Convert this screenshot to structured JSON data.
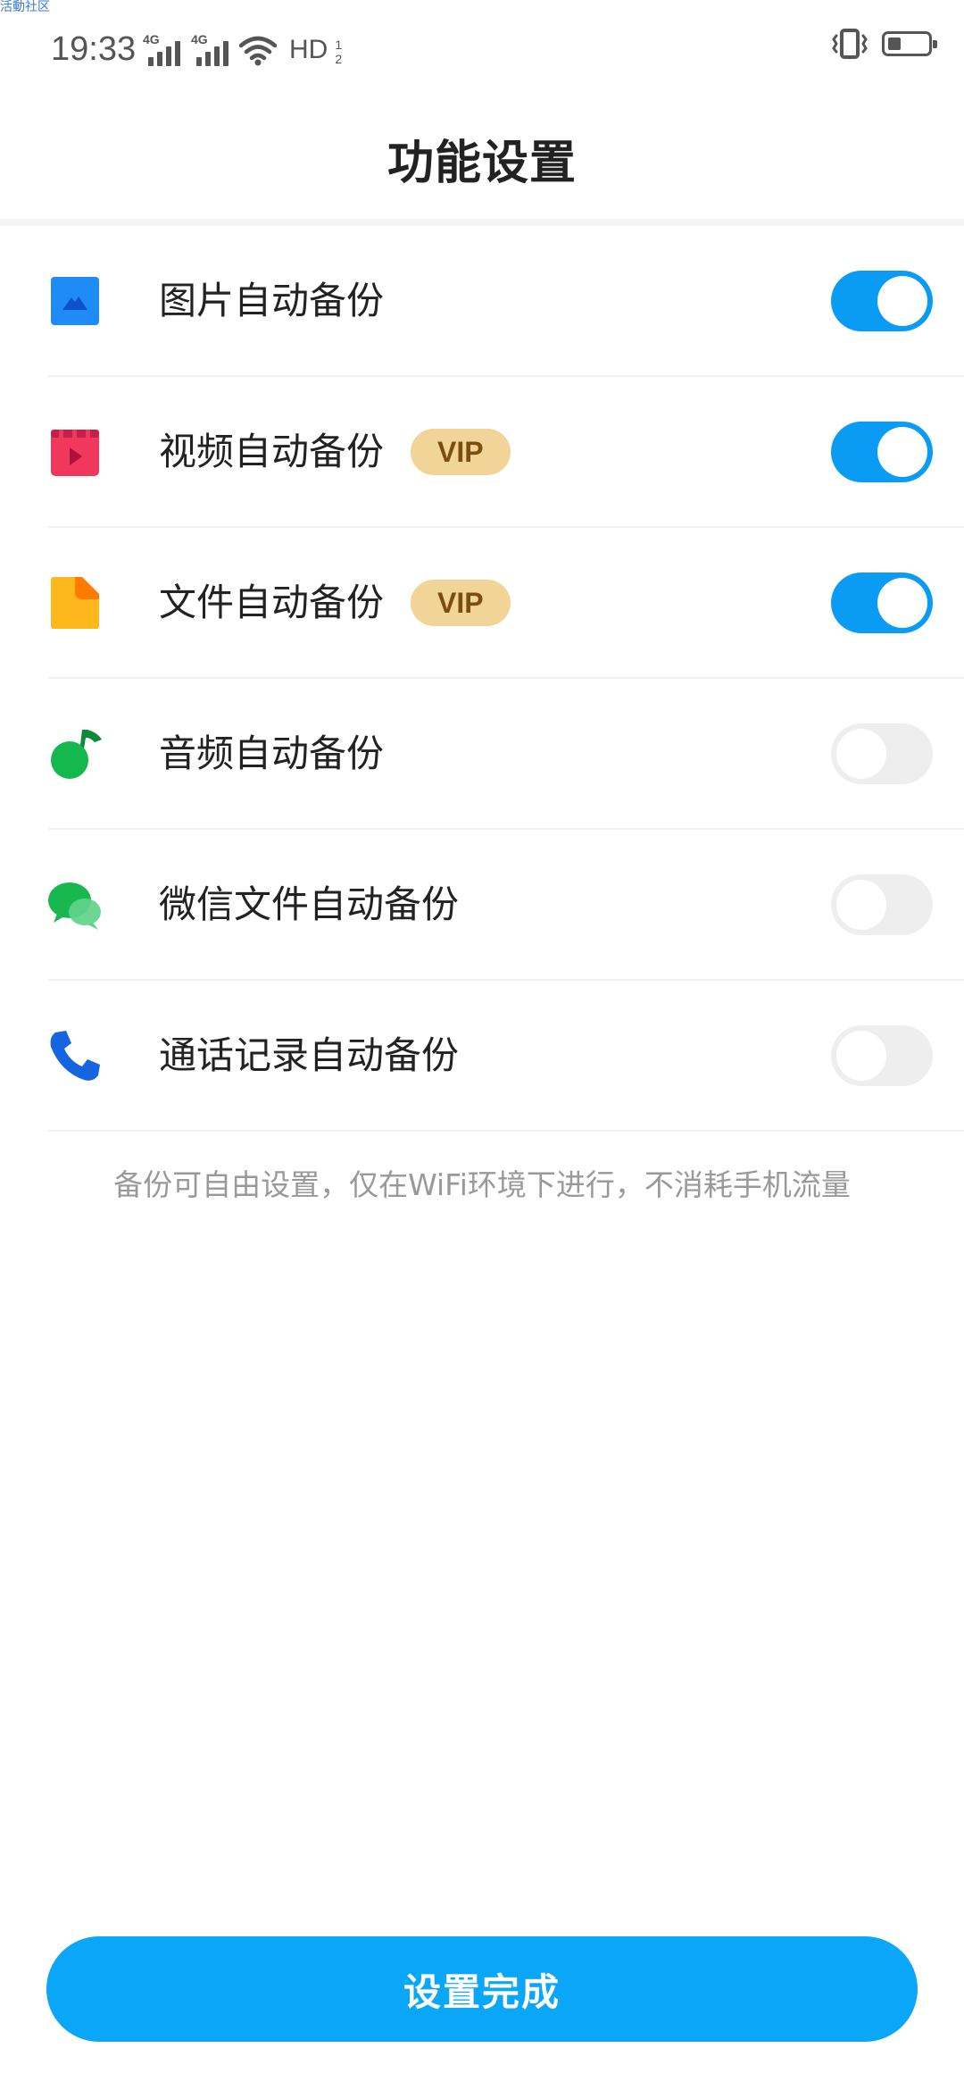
{
  "watermark": "活動社区",
  "status_bar": {
    "time": "19:33",
    "signal1_label": "4G",
    "signal2_label": "4G",
    "hd_label": "HD",
    "hd_sub_top": "1",
    "hd_sub_bottom": "2"
  },
  "header": {
    "title": "功能设置"
  },
  "settings": [
    {
      "label": "图片自动备份",
      "vip": "",
      "enabled": true,
      "icon": "image-icon"
    },
    {
      "label": "视频自动备份",
      "vip": "VIP",
      "enabled": true,
      "icon": "video-icon"
    },
    {
      "label": "文件自动备份",
      "vip": "VIP",
      "enabled": true,
      "icon": "file-icon"
    },
    {
      "label": "音频自动备份",
      "vip": "",
      "enabled": false,
      "icon": "music-icon"
    },
    {
      "label": "微信文件自动备份",
      "vip": "",
      "enabled": false,
      "icon": "wechat-icon"
    },
    {
      "label": "通话记录自动备份",
      "vip": "",
      "enabled": false,
      "icon": "phone-icon"
    }
  ],
  "hint": "备份可自由设置，仅在WiFi环境下进行，不消耗手机流量",
  "done_button": "设置完成",
  "colors": {
    "accent": "#0a9bf5",
    "vip_bg": "#f1d497",
    "toggle_off": "#eeeeee"
  }
}
